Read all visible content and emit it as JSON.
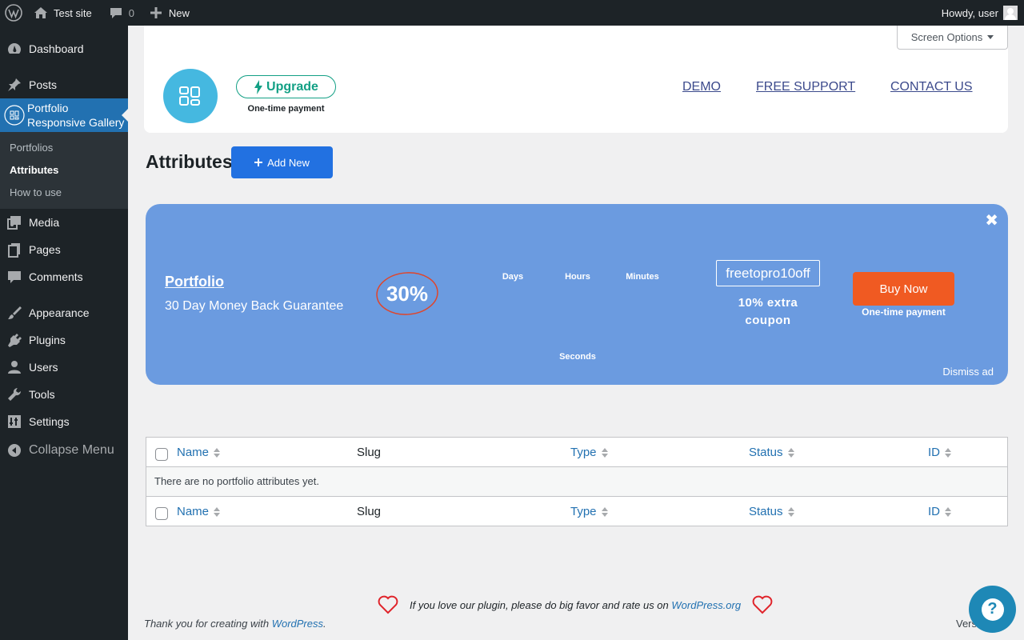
{
  "adminbar": {
    "site_name": "Test site",
    "comments_count": "0",
    "new_label": "New",
    "howdy": "Howdy, user"
  },
  "sidebar": {
    "items": [
      {
        "label": "Dashboard",
        "icon": "dashboard-icon"
      },
      {
        "label": "Posts",
        "icon": "pin-icon"
      },
      {
        "label": "Portfolio Responsive Gallery",
        "icon": "gallery-icon"
      },
      {
        "label": "Media",
        "icon": "media-icon"
      },
      {
        "label": "Pages",
        "icon": "pages-icon"
      },
      {
        "label": "Comments",
        "icon": "comments-icon"
      },
      {
        "label": "Appearance",
        "icon": "brush-icon"
      },
      {
        "label": "Plugins",
        "icon": "plug-icon"
      },
      {
        "label": "Users",
        "icon": "user-icon"
      },
      {
        "label": "Tools",
        "icon": "wrench-icon"
      },
      {
        "label": "Settings",
        "icon": "settings-icon"
      },
      {
        "label": "Collapse Menu",
        "icon": "collapse-icon"
      }
    ],
    "submenu": [
      "Portfolios",
      "Attributes",
      "How to use"
    ]
  },
  "topbar": {
    "upgrade_label": "Upgrade",
    "one_time": "One-time payment",
    "links": [
      "DEMO",
      "FREE SUPPORT",
      "CONTACT US"
    ],
    "screen_options": "Screen Options"
  },
  "page": {
    "title": "Attributes",
    "add_new": "Add New"
  },
  "promo": {
    "title": "Portfolio",
    "subtitle": "30 Day Money Back Guarantee",
    "discount": "30%",
    "countdown": {
      "days": "Days",
      "hours": "Hours",
      "minutes": "Minutes",
      "seconds": "Seconds"
    },
    "coupon_code": "freetopro10off",
    "coupon_desc_1": "10% extra",
    "coupon_desc_2": "coupon",
    "buy_now": "Buy Now",
    "buy_sub": "One-time payment",
    "dismiss": "Dismiss ad",
    "close": "✖"
  },
  "table": {
    "columns": [
      "Name",
      "Slug",
      "Type",
      "Status",
      "ID"
    ],
    "empty_message": "There are no portfolio attributes yet."
  },
  "footer": {
    "rate_prefix": "If you love our plugin, please do big favor and rate us on",
    "rate_link": "WordPress.org",
    "thanks_prefix": "Thank you for creating with",
    "thanks_link": "WordPress",
    "thanks_suffix": ".",
    "version_partial": "Vers",
    "help": "?"
  }
}
